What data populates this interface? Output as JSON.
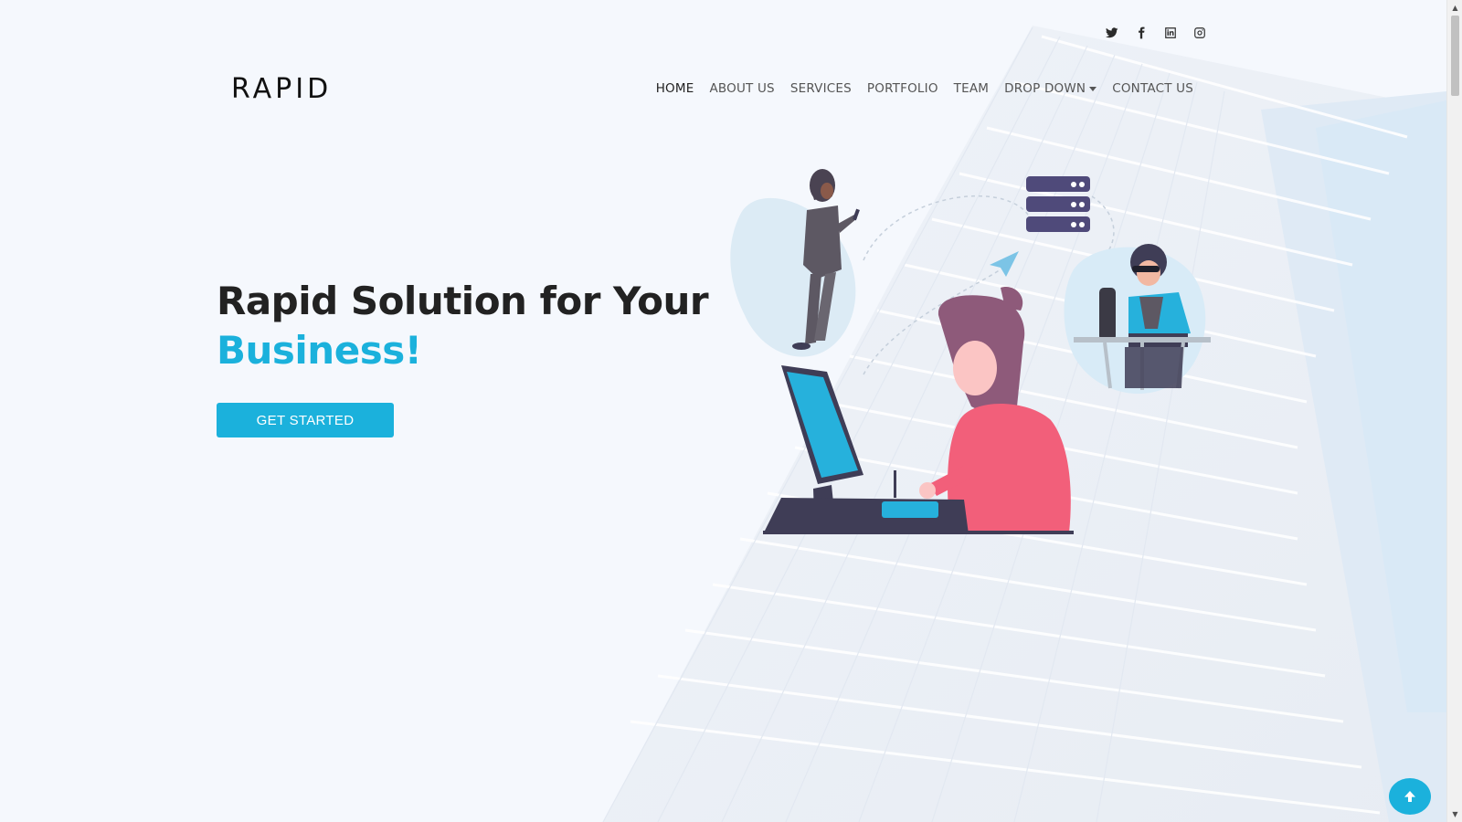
{
  "social": {
    "items": [
      {
        "name": "twitter",
        "icon": "twitter-icon"
      },
      {
        "name": "facebook",
        "icon": "facebook-icon"
      },
      {
        "name": "linkedin",
        "icon": "linkedin-icon"
      },
      {
        "name": "instagram",
        "icon": "instagram-icon"
      }
    ]
  },
  "header": {
    "logo": "RAPID",
    "nav": [
      {
        "label": "HOME",
        "active": true
      },
      {
        "label": "ABOUT US"
      },
      {
        "label": "SERVICES"
      },
      {
        "label": "PORTFOLIO"
      },
      {
        "label": "TEAM"
      },
      {
        "label": "DROP DOWN",
        "dropdown": true
      },
      {
        "label": "CONTACT US"
      }
    ]
  },
  "hero": {
    "title_line1": "Rapid Solution for Your",
    "title_line2": "Business!",
    "cta_label": "GET STARTED"
  },
  "colors": {
    "accent": "#1bb1dc",
    "background": "#f5f8fd",
    "text_dark": "#222222"
  },
  "back_to_top": {
    "icon": "arrow-up-icon"
  }
}
